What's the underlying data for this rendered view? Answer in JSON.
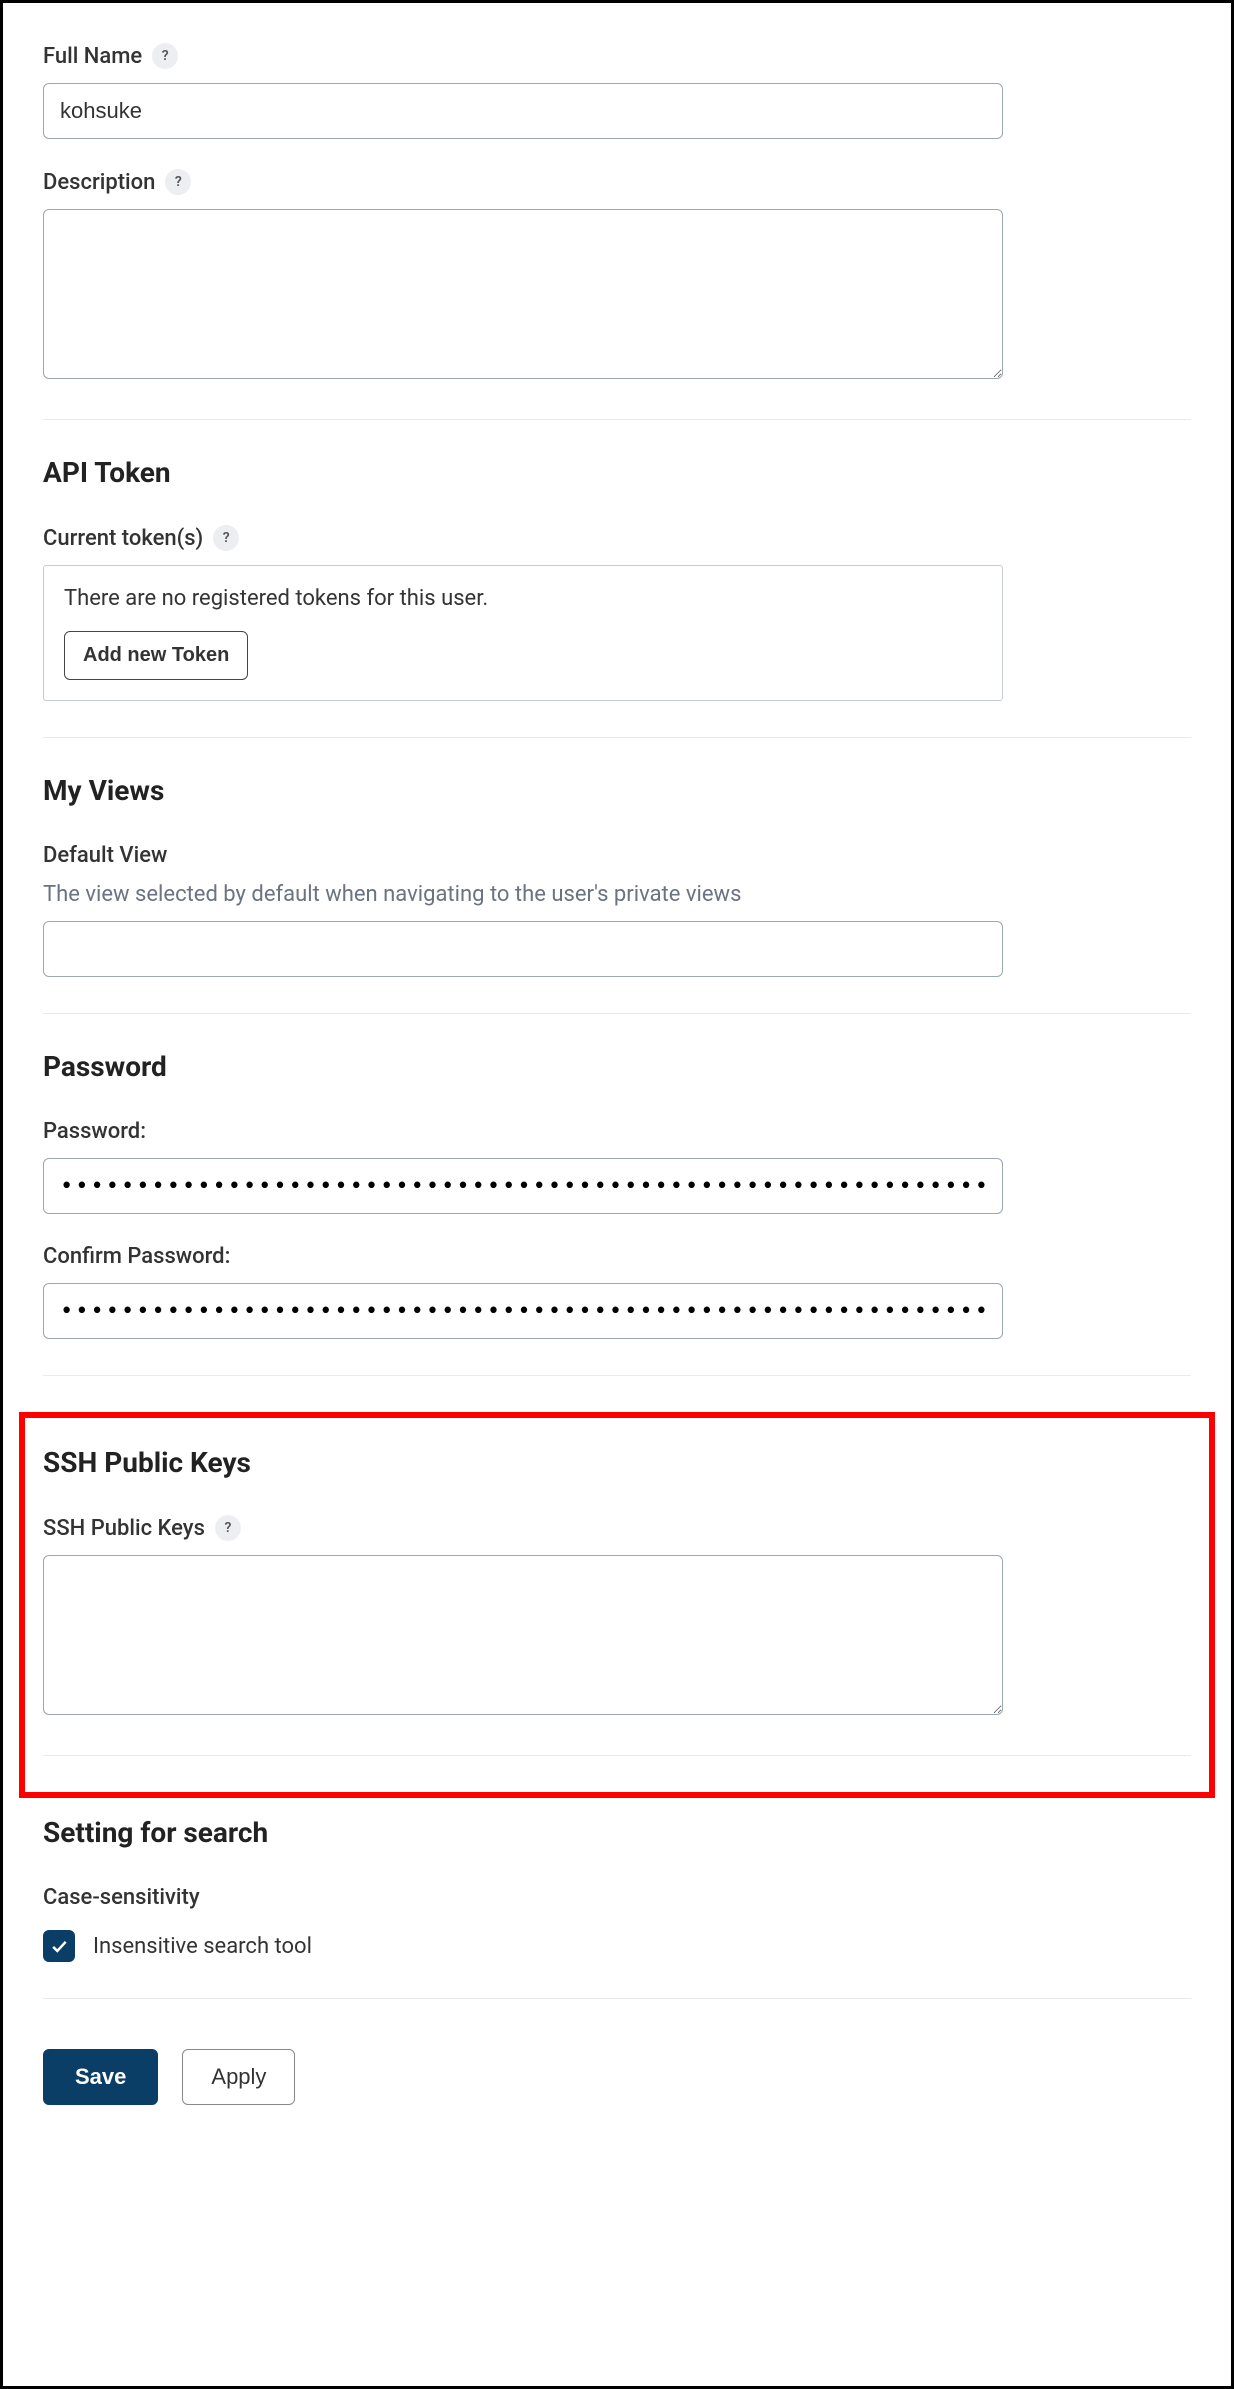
{
  "fullName": {
    "label": "Full Name",
    "value": "kohsuke"
  },
  "description": {
    "label": "Description",
    "value": ""
  },
  "apiToken": {
    "title": "API Token",
    "currentTokensLabel": "Current token(s)",
    "noTokensText": "There are no registered tokens for this user.",
    "addButton": "Add new Token"
  },
  "myViews": {
    "title": "My Views",
    "defaultViewLabel": "Default View",
    "description": "The view selected by default when navigating to the user's private views",
    "value": ""
  },
  "password": {
    "title": "Password",
    "passwordLabel": "Password:",
    "passwordValue": "••••••••••••••••••••••••••••••••••••••••••••••••••••••••••••••••••••••••••••••••••••••••••••••••••••••••••••••••",
    "confirmLabel": "Confirm Password:",
    "confirmValue": "••••••••••••••••••••••••••••••••••••••••••••••••••••••••••••••••••••••••••••••••••••••••••••••••••••••••••••••••"
  },
  "sshKeys": {
    "title": "SSH Public Keys",
    "label": "SSH Public Keys",
    "value": ""
  },
  "search": {
    "title": "Setting for search",
    "caseSensitivityLabel": "Case-sensitivity",
    "checkboxLabel": "Insensitive search tool",
    "checked": true
  },
  "buttons": {
    "save": "Save",
    "apply": "Apply"
  },
  "helpIcon": "?"
}
